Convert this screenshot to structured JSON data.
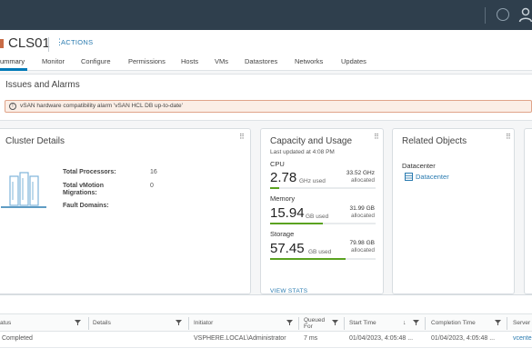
{
  "header": {
    "title": "CLS01",
    "actions_label": "ACTIONS",
    "tabs": [
      {
        "label": "Summary",
        "display": "ummary"
      },
      {
        "label": "Monitor"
      },
      {
        "label": "Configure"
      },
      {
        "label": "Permissions"
      },
      {
        "label": "Hosts"
      },
      {
        "label": "VMs"
      },
      {
        "label": "Datastores"
      },
      {
        "label": "Networks"
      },
      {
        "label": "Updates"
      }
    ]
  },
  "issues": {
    "title": "Issues and Alarms",
    "alarm_text": "vSAN hardware compatibility alarm 'vSAN HCL DB up-to-date'"
  },
  "cluster_details": {
    "title": "Cluster Details",
    "stats": [
      {
        "label": "Total Processors:",
        "value": "16"
      },
      {
        "label": "Total vMotion Migrations:",
        "value": "0"
      },
      {
        "label": "Fault Domains:",
        "value": ""
      }
    ]
  },
  "capacity": {
    "title": "Capacity and Usage",
    "updated": "Last updated at 4:08 PM",
    "cpu": {
      "label": "CPU",
      "used": "2.78",
      "unit": "GHz used",
      "capacity": "33.52 GHz",
      "cap_label": "allocated",
      "fraction": 0.083
    },
    "memory": {
      "label": "Memory",
      "used": "15.94",
      "unit": "GB used",
      "capacity": "31.99 GB",
      "cap_label": "allocated",
      "fraction": 0.498
    },
    "storage": {
      "label": "Storage",
      "used": "57.45",
      "unit": "GB used",
      "capacity": "79.98 GB",
      "cap_label": "allocated",
      "fraction": 0.718
    },
    "view_stats": "VIEW STATS"
  },
  "related": {
    "title": "Related Objects",
    "datacenter_label": "Datacenter",
    "datacenter_link": "Datacenter"
  },
  "tasks": {
    "columns": [
      "atus",
      "Details",
      "Initiator",
      "Queued For",
      "Start Time",
      "Completion Time",
      "Server"
    ],
    "queued_line1": "Queued",
    "queued_line2": "For",
    "row": {
      "status": "Completed",
      "details": "",
      "initiator": "VSPHERE.LOCAL\\Administrator",
      "queued": "7 ms",
      "start": "01/04/2023, 4:05:48 ...",
      "completion": "01/04/2023, 4:05:48 ...",
      "server": "vcente"
    }
  }
}
